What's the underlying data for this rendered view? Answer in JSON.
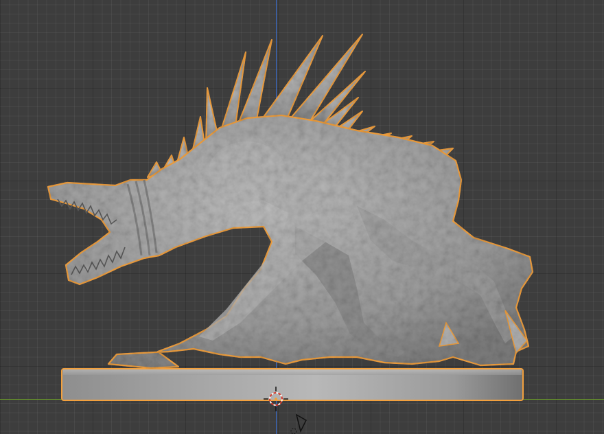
{
  "viewport": {
    "background_color": "#3d3d3d",
    "grid_color": "#2a2a2a",
    "z_axis_color": "#3b6ecf",
    "y_axis_color": "#6a9a2a",
    "selection_outline_color": "#f2a03d",
    "mesh_color": "#a8a8a8",
    "base_color": "#a0a0a0"
  },
  "scene": {
    "object": "sculpted-creature-miniature-on-round-base",
    "selected": true,
    "icons": {
      "origin": "3d-cursor-icon",
      "light": "light-object-icon"
    }
  }
}
